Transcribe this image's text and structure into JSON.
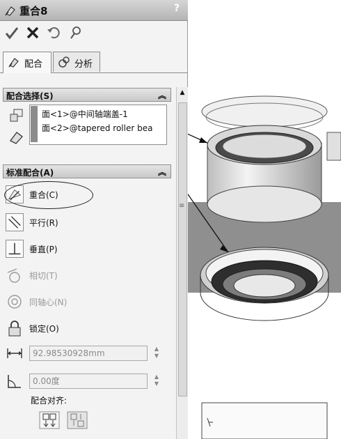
{
  "title_bar": {
    "title": "重合8",
    "help": "?"
  },
  "toolbar": {
    "ok_icon": "check-icon",
    "cancel_icon": "close-icon",
    "undo_icon": "undo-icon",
    "pin_icon": "pushpin-icon"
  },
  "tabs": [
    {
      "label": "配合",
      "icon": "mate-icon",
      "active": true
    },
    {
      "label": "分析",
      "icon": "analysis-icon",
      "active": false
    }
  ],
  "mate_selections": {
    "header": "配合选择(S)",
    "items": [
      "面<1>@中间轴端盖-1",
      "面<2>@tapered roller bea"
    ]
  },
  "standard_mates": {
    "header": "标准配合(A)",
    "items": [
      {
        "label": "重合(C)",
        "icon": "coincident-icon",
        "enabled": true,
        "selected": true
      },
      {
        "label": "平行(R)",
        "icon": "parallel-icon",
        "enabled": true
      },
      {
        "label": "垂直(P)",
        "icon": "perpendicular-icon",
        "enabled": true
      },
      {
        "label": "相切(T)",
        "icon": "tangent-icon",
        "enabled": false
      },
      {
        "label": "同轴心(N)",
        "icon": "concentric-icon",
        "enabled": false
      },
      {
        "label": "锁定(O)",
        "icon": "lock-icon",
        "enabled": true
      }
    ],
    "distance_value": "92.98530928mm",
    "angle_value": "0.00度",
    "alignment_label": "配合对齐:"
  },
  "colors": {
    "panel_bg": "#f3f3f3",
    "header_bg": "#d0d0d0",
    "model_gray": "#a9a9a9",
    "plane_gray": "#8f8f8f"
  }
}
